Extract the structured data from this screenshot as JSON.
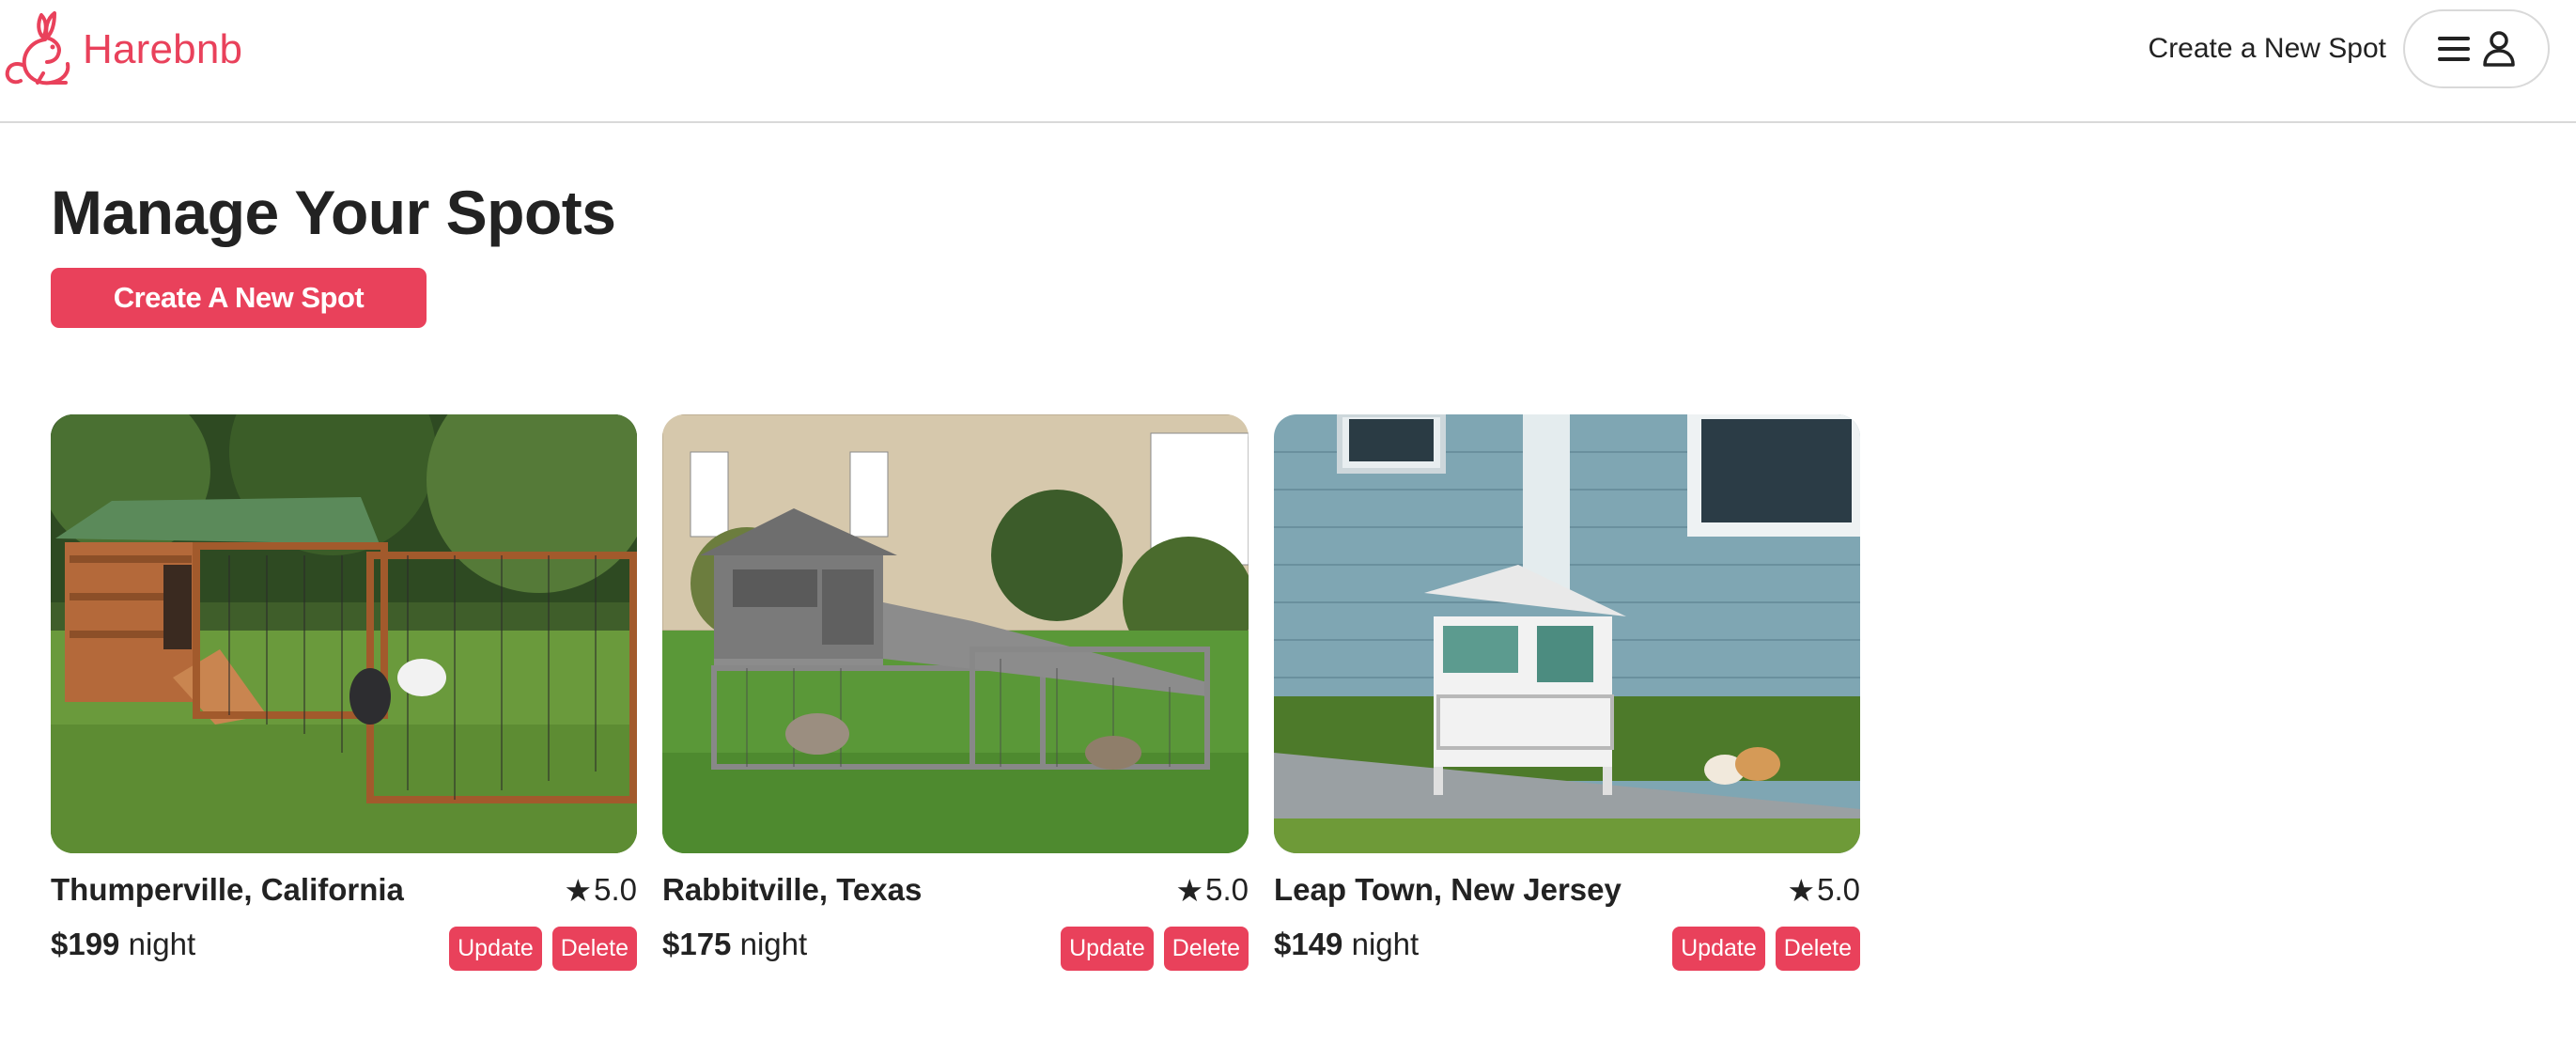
{
  "brand": {
    "name": "Harebnb",
    "color": "#e9415b"
  },
  "header": {
    "create_link": "Create a New Spot",
    "menu_icon": "hamburger-icon",
    "user_icon": "user-icon"
  },
  "main": {
    "title": "Manage Your Spots",
    "create_button": "Create A New Spot"
  },
  "spots": [
    {
      "location": "Thumperville, California",
      "rating": "5.0",
      "price": "$199",
      "price_unit": "night",
      "update_label": "Update",
      "delete_label": "Delete",
      "image_desc": "wooden rabbit hutch on lawn"
    },
    {
      "location": "Rabbitville, Texas",
      "rating": "5.0",
      "price": "$175",
      "price_unit": "night",
      "update_label": "Update",
      "delete_label": "Delete",
      "image_desc": "grey rabbit hutch with ramp in front of stone house"
    },
    {
      "location": "Leap Town, New Jersey",
      "rating": "5.0",
      "price": "$149",
      "price_unit": "night",
      "update_label": "Update",
      "delete_label": "Delete",
      "image_desc": "white hutch beside blue house with guinea pigs"
    }
  ]
}
